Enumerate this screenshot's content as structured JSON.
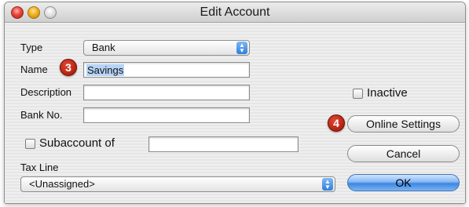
{
  "window": {
    "title": "Edit Account"
  },
  "form": {
    "type_label": "Type",
    "type_value": "Bank",
    "name_label": "Name",
    "name_value": "Savings",
    "description_label": "Description",
    "description_value": "",
    "bank_no_label": "Bank No.",
    "bank_no_value": "",
    "inactive_label": "Inactive",
    "subaccount_label": "Subaccount of",
    "subaccount_value": "",
    "tax_line_label": "Tax Line",
    "tax_line_value": "<Unassigned>"
  },
  "buttons": {
    "online_settings": "Online Settings",
    "cancel": "Cancel",
    "ok": "OK"
  },
  "annotations": {
    "step_3": "3",
    "step_4": "4"
  },
  "colors": {
    "callout_red": "#b5200f",
    "default_button_blue": "#3d86e0",
    "selection_highlight": "#b6d4f7"
  }
}
